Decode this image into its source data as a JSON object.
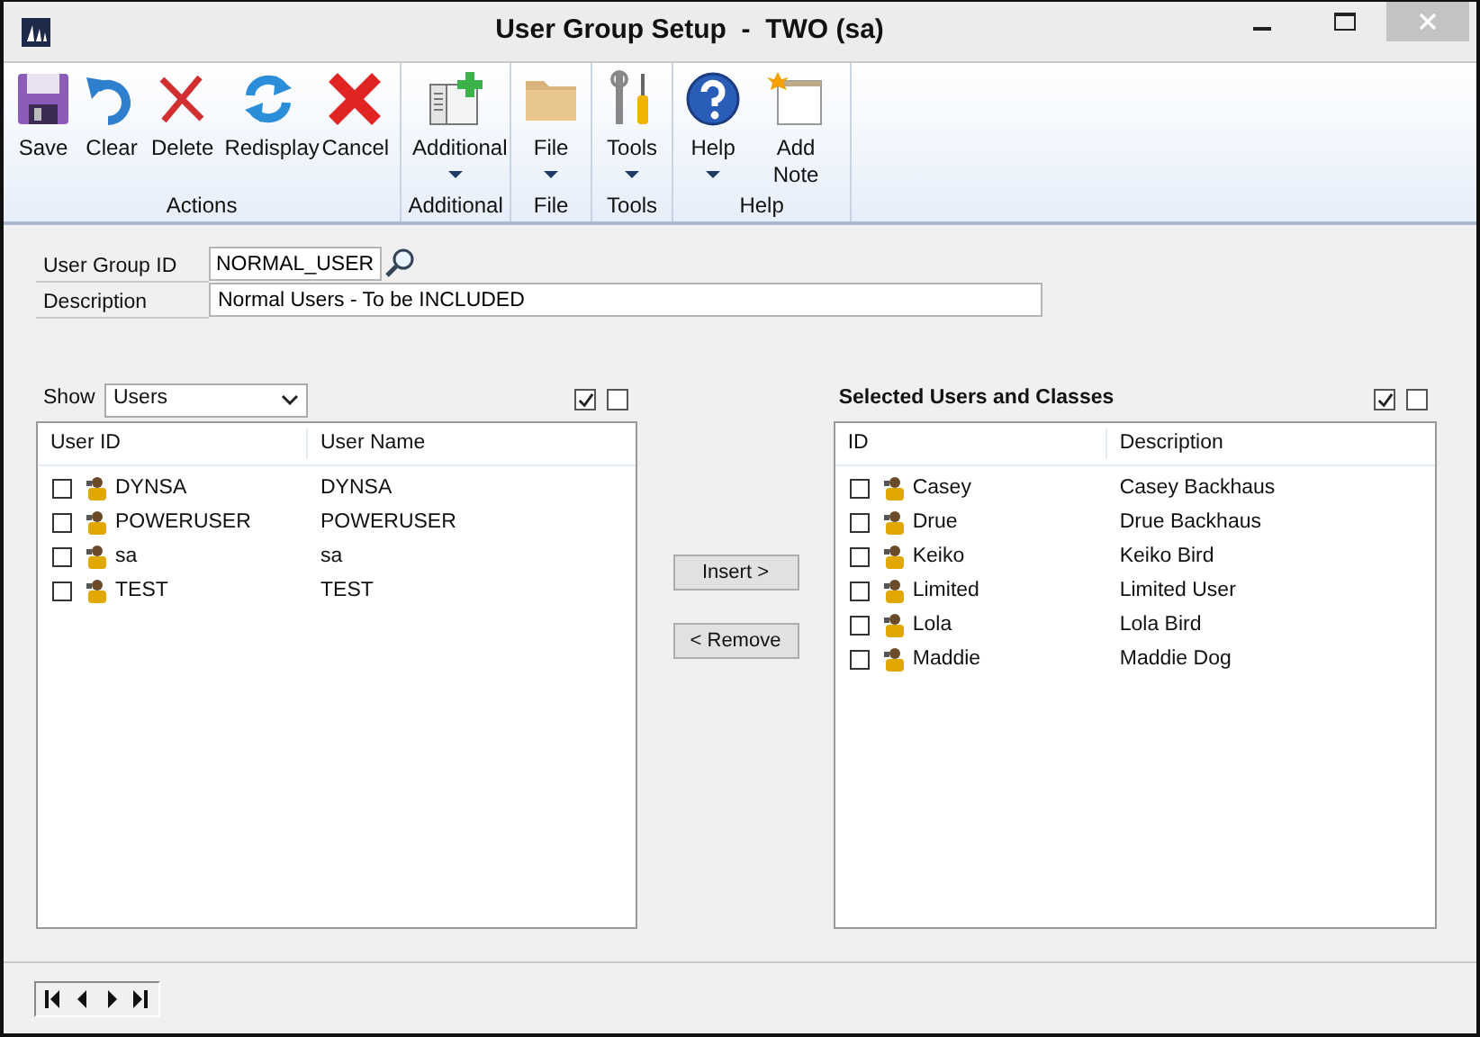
{
  "window": {
    "title": "User Group Setup  -  TWO (sa)"
  },
  "ribbon": {
    "groups": [
      {
        "label": "Actions",
        "buttons": [
          {
            "label": "Save",
            "kind": "save"
          },
          {
            "label": "Clear",
            "kind": "clear"
          },
          {
            "label": "Delete",
            "kind": "delete"
          },
          {
            "label": "Redisplay",
            "kind": "redisplay"
          },
          {
            "label": "Cancel",
            "kind": "cancel"
          }
        ]
      },
      {
        "label": "Additional",
        "buttons": [
          {
            "label": "Additional",
            "kind": "additional",
            "dropdown": true
          }
        ]
      },
      {
        "label": "File",
        "buttons": [
          {
            "label": "File",
            "kind": "file",
            "dropdown": true
          }
        ]
      },
      {
        "label": "Tools",
        "buttons": [
          {
            "label": "Tools",
            "kind": "tools",
            "dropdown": true
          }
        ]
      },
      {
        "label": "Help",
        "buttons": [
          {
            "label": "Help",
            "kind": "help",
            "dropdown": true
          },
          {
            "label": "Add Note",
            "kind": "note"
          }
        ]
      }
    ]
  },
  "form": {
    "user_group_id": {
      "label": "User Group ID",
      "value": "NORMAL_USER"
    },
    "description": {
      "label": "Description",
      "value": "Normal Users - To be INCLUDED"
    }
  },
  "available": {
    "show_label": "Show",
    "show_value": "Users",
    "mark_all": [
      {
        "checked": true
      },
      {
        "checked": false
      }
    ],
    "columns": [
      "User ID",
      "User Name"
    ],
    "rows": [
      {
        "id": "DYNSA",
        "name": "DYNSA",
        "checked": false
      },
      {
        "id": "POWERUSER",
        "name": "POWERUSER",
        "checked": false
      },
      {
        "id": "sa",
        "name": "sa",
        "checked": false
      },
      {
        "id": "TEST",
        "name": "TEST",
        "checked": false
      }
    ]
  },
  "transfer_buttons": [
    "Insert >",
    "< Remove"
  ],
  "selected": {
    "title": "Selected Users and Classes",
    "mark_all": [
      {
        "checked": true
      },
      {
        "checked": false
      }
    ],
    "columns": [
      "ID",
      "Description"
    ],
    "rows": [
      {
        "id": "Casey",
        "name": "Casey Backhaus",
        "checked": false
      },
      {
        "id": "Drue",
        "name": "Drue Backhaus",
        "checked": false
      },
      {
        "id": "Keiko",
        "name": "Keiko Bird",
        "checked": false
      },
      {
        "id": "Limited",
        "name": "Limited User",
        "checked": false
      },
      {
        "id": "Lola",
        "name": "Lola Bird",
        "checked": false
      },
      {
        "id": "Maddie",
        "name": "Maddie Dog",
        "checked": false
      }
    ]
  }
}
